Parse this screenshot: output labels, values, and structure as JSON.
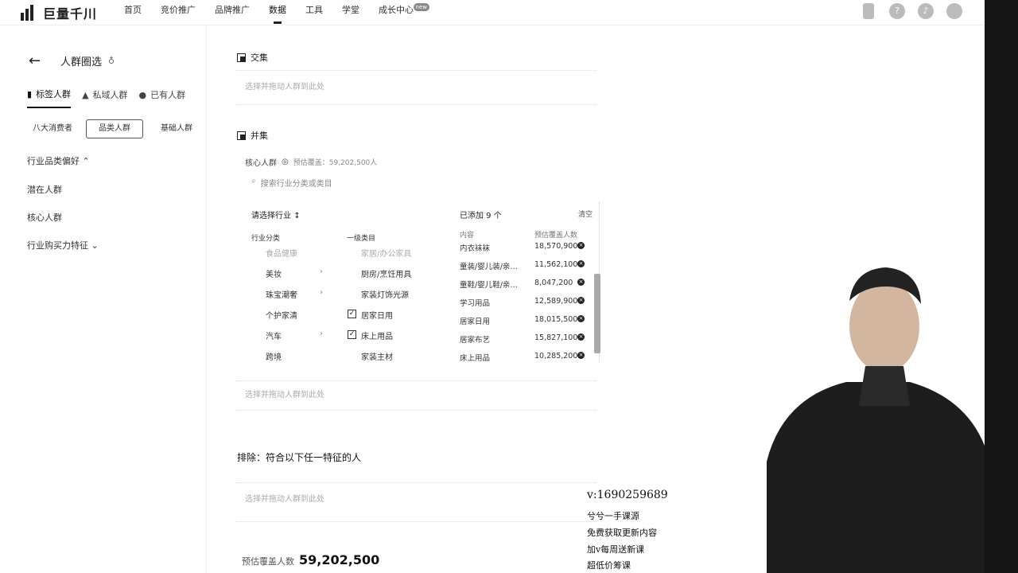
{
  "brand": {
    "name": "巨量千川"
  },
  "nav": [
    "首页",
    "竞价推广",
    "品牌推广",
    "数据",
    "工具",
    "学堂",
    "成长中心"
  ],
  "nav_badge": "new",
  "page": {
    "title": "人群圈选"
  },
  "left_tabs": [
    "标签人群",
    "私域人群",
    "已有人群"
  ],
  "sub_tabs": [
    "八大消费者",
    "品类人群",
    "基础人群"
  ],
  "left_menu": [
    "行业品类偏好",
    "潜在人群",
    "核心人群",
    "行业购买力特征"
  ],
  "intersection": {
    "title": "交集",
    "placeholder": "选择并拖动人群到此处"
  },
  "union": {
    "title": "并集",
    "placeholder": "选择并拖动人群到此处"
  },
  "core_crowd": {
    "label": "核心人群",
    "estimate": "预估覆盖：59,202,500人"
  },
  "search_placeholder": "搜索行业分类或类目",
  "selector": {
    "title": "请选择行业",
    "col_industry": "行业分类",
    "col_category": "一级类目",
    "industries": [
      "食品健康",
      "美妆",
      "珠宝潮奢",
      "个护家清",
      "汽车",
      "跨境"
    ],
    "categories": [
      "家居/办公家具",
      "厨房/烹饪用具",
      "家装灯饰光源",
      "居家日用",
      "床上用品",
      "家装主材"
    ]
  },
  "added": {
    "title": "已添加 9 个",
    "clear": "清空",
    "col_content": "内容",
    "col_estimate": "预估覆盖人数",
    "rows": [
      {
        "name": "内衣袜袜",
        "value": "18,570,900"
      },
      {
        "name": "童装/婴儿装/亲…",
        "value": "11,562,100"
      },
      {
        "name": "童鞋/婴儿鞋/亲…",
        "value": "8,047,200"
      },
      {
        "name": "学习用品",
        "value": "12,589,900"
      },
      {
        "name": "居家日用",
        "value": "18,015,500"
      },
      {
        "name": "居家布艺",
        "value": "15,827,100"
      },
      {
        "name": "床上用品",
        "value": "10,285,200"
      }
    ]
  },
  "exclude": {
    "title": "排除：符合以下任一特征的人",
    "placeholder": "选择并拖动人群到此处"
  },
  "footer": {
    "label": "预估覆盖人数",
    "value": "59,202,500"
  },
  "overlay": {
    "contact": "v:1690259689",
    "lines": [
      "兮兮一手课源",
      "免费获取更新内容",
      "加v每周送新课",
      "超低价筹课"
    ]
  }
}
